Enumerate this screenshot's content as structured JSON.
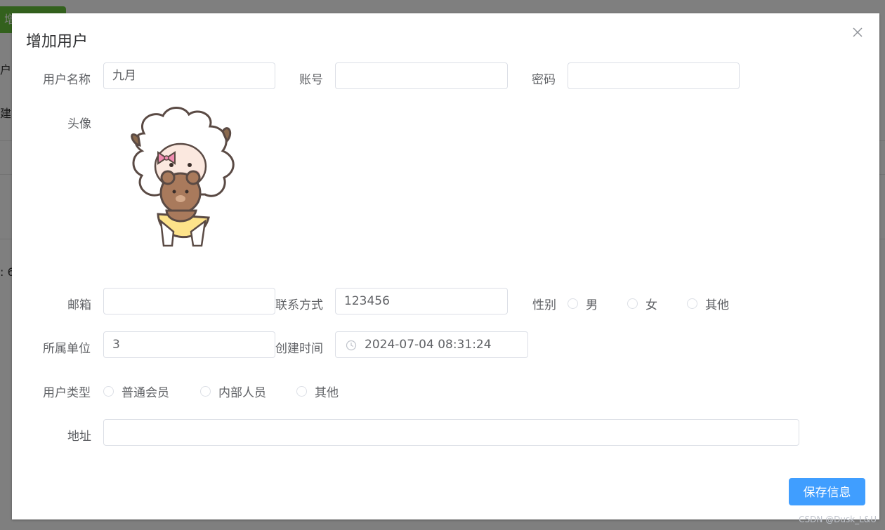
{
  "background": {
    "add_button_label": "增",
    "text_fragments": [
      "户",
      "建",
      ": 6"
    ]
  },
  "dialog": {
    "title": "增加用户",
    "close_icon": "close-icon"
  },
  "form": {
    "username": {
      "label": "用户名称",
      "value": "九月"
    },
    "account": {
      "label": "账号",
      "value": ""
    },
    "password": {
      "label": "密码",
      "value": ""
    },
    "avatar": {
      "label": "头像",
      "image": "sheep-cartoon-avatar"
    },
    "email": {
      "label": "邮箱",
      "value": ""
    },
    "contact": {
      "label": "联系方式",
      "value": "123456"
    },
    "gender": {
      "label": "性别",
      "options": [
        "男",
        "女",
        "其他"
      ]
    },
    "unit": {
      "label": "所属单位",
      "value": "3"
    },
    "created": {
      "label": "创建时间",
      "value": "2024-07-04 08:31:24",
      "icon": "clock-icon"
    },
    "user_type": {
      "label": "用户类型",
      "options": [
        "普通会员",
        "内部人员",
        "其他"
      ]
    },
    "address": {
      "label": "地址",
      "value": ""
    }
  },
  "footer": {
    "save_label": "保存信息"
  },
  "watermark": "CSDN @Dusk_L&U",
  "colors": {
    "primary": "#409eff",
    "success": "#67c23a",
    "border": "#dcdfe6",
    "label": "#606266"
  }
}
